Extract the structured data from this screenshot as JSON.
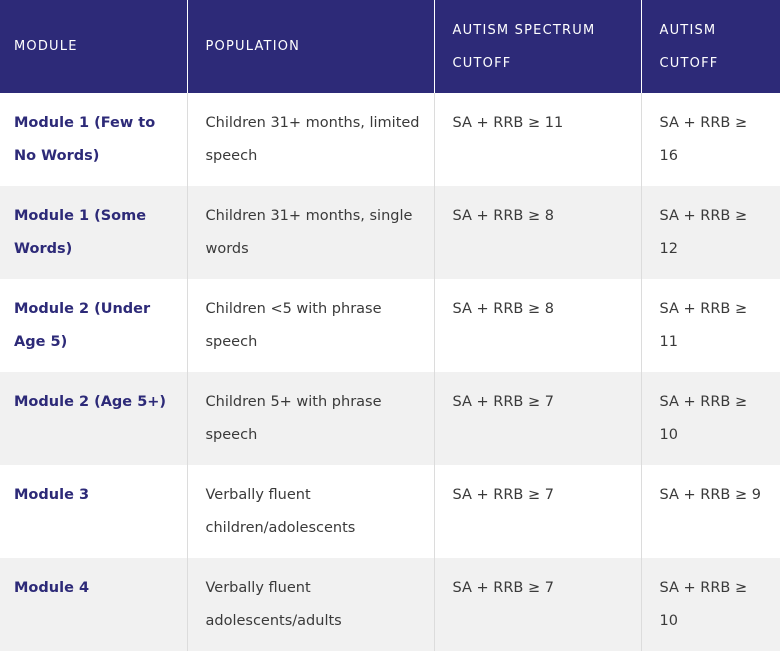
{
  "table": {
    "headers": [
      "MODULE",
      "POPULATION",
      "AUTISM SPECTRUM CUTOFF",
      "AUTISM CUTOFF"
    ],
    "rows": [
      [
        "Module 1 (Few to No Words)",
        "Children 31+ months, limited speech",
        "SA + RRB ≥ 11",
        "SA + RRB ≥ 16"
      ],
      [
        "Module 1 (Some Words)",
        "Children 31+ months, single words",
        "SA + RRB ≥ 8",
        "SA + RRB ≥ 12"
      ],
      [
        "Module 2 (Under Age 5)",
        "Children <5 with phrase speech",
        "SA + RRB ≥ 8",
        "SA + RRB ≥ 11"
      ],
      [
        "Module 2 (Age 5+)",
        "Children 5+ with phrase speech",
        "SA + RRB ≥ 7",
        "SA + RRB ≥ 10"
      ],
      [
        "Module 3",
        "Verbally fluent children/adolescents",
        "SA + RRB ≥ 7",
        "SA + RRB ≥ 9"
      ],
      [
        "Module 4",
        "Verbally fluent adolescents/adults",
        "SA + RRB ≥ 7",
        "SA + RRB ≥ 10"
      ]
    ]
  },
  "colors": {
    "header_bg": "#2d2a78",
    "header_text": "#ffffff",
    "module_text": "#2d2a78",
    "body_text": "#3a3a3a",
    "alt_row_bg": "#f1f1f1"
  }
}
